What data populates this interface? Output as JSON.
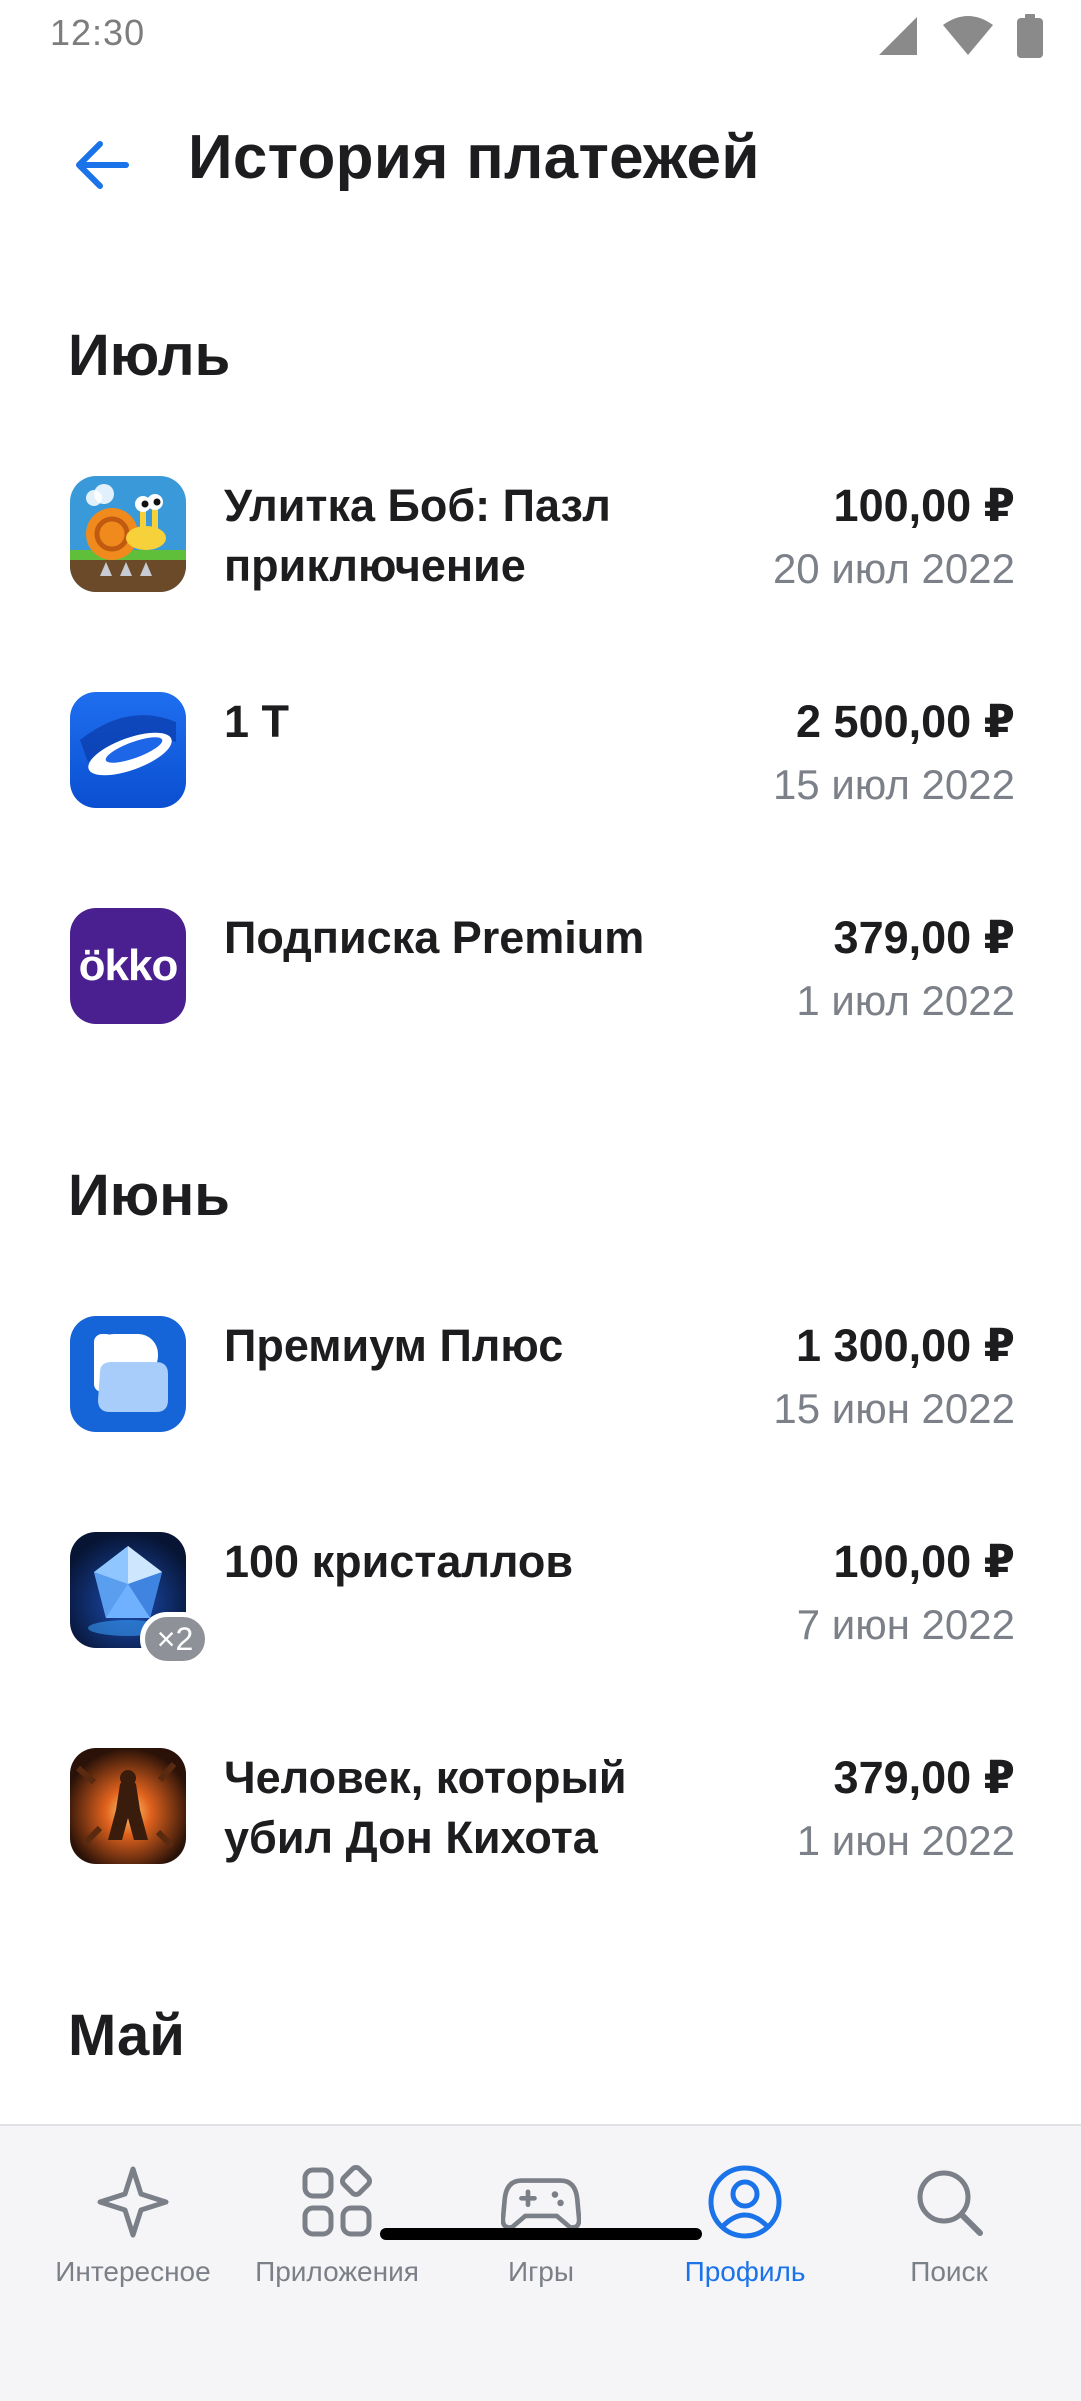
{
  "status_bar": {
    "time": "12:30"
  },
  "header": {
    "title": "История платежей"
  },
  "sections": [
    {
      "title": "Июль",
      "items": [
        {
          "name": "Улитка Боб: Пазл приключение",
          "price": "100,00 ₽",
          "date": "20 июл 2022",
          "icon": "snail-bob-app-icon"
        },
        {
          "name": "1 Т",
          "price": "2 500,00 ₽",
          "date": "15 июл 2022",
          "icon": "blue-ellipse-app-icon"
        },
        {
          "name": "Подписка Premium",
          "price": "379,00 ₽",
          "date": "1 июл 2022",
          "icon": "okko-app-icon",
          "icon_text": "ökko"
        }
      ]
    },
    {
      "title": "Июнь",
      "items": [
        {
          "name": "Премиум Плюс",
          "price": "1 300,00 ₽",
          "date": "15 июн 2022",
          "icon": "chat-bubble-app-icon"
        },
        {
          "name": "100 кристаллов",
          "price": "100,00 ₽",
          "date": "7 июн 2022",
          "icon": "crystal-app-icon",
          "badge": "×2"
        },
        {
          "name": "Человек, который убил Дон Кихота",
          "price": "379,00 ₽",
          "date": "1 июн 2022",
          "icon": "movie-poster-icon"
        }
      ]
    },
    {
      "title": "Май",
      "items": []
    }
  ],
  "nav": {
    "items": [
      {
        "label": "Интересное",
        "icon": "star-icon"
      },
      {
        "label": "Приложения",
        "icon": "apps-grid-icon"
      },
      {
        "label": "Игры",
        "icon": "gamepad-icon"
      },
      {
        "label": "Профиль",
        "icon": "profile-icon",
        "active": true
      },
      {
        "label": "Поиск",
        "icon": "search-icon"
      }
    ]
  },
  "colors": {
    "accent": "#1a73e8",
    "text": "#1d1d1f",
    "secondary": "#7c8088",
    "nav_bg": "#f5f5f7"
  }
}
